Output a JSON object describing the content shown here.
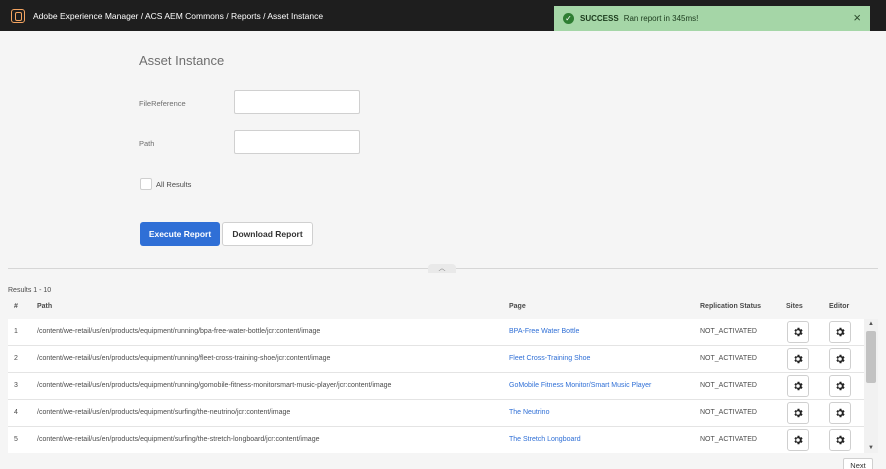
{
  "header": {
    "breadcrumb": "Adobe Experience Manager / ACS AEM Commons / Reports / Asset Instance"
  },
  "toast": {
    "status": "SUCCESS",
    "message": "Ran report in 345ms!",
    "close": "×"
  },
  "form": {
    "title": "Asset Instance",
    "file_reference_label": "FileReference",
    "file_reference_value": "",
    "path_label": "Path",
    "path_value": "",
    "all_results_label": "All Results",
    "execute_label": "Execute Report",
    "download_label": "Download Report"
  },
  "results": {
    "count_text": "Results 1 - 10",
    "headers": {
      "num": "#",
      "path": "Path",
      "page": "Page",
      "status": "Replication Status",
      "sites": "Sites",
      "editor": "Editor"
    },
    "rows": [
      {
        "num": "1",
        "path": "/content/we-retail/us/en/products/equipment/running/bpa-free-water-bottle/jcr:content/image",
        "page": "BPA-Free Water Bottle",
        "status": "NOT_ACTIVATED"
      },
      {
        "num": "2",
        "path": "/content/we-retail/us/en/products/equipment/running/fleet-cross-training-shoe/jcr:content/image",
        "page": "Fleet Cross-Training Shoe",
        "status": "NOT_ACTIVATED"
      },
      {
        "num": "3",
        "path": "/content/we-retail/us/en/products/equipment/running/gomobile-fitness-monitorsmart-music-player/jcr:content/image",
        "page": "GoMobile Fitness Monitor/Smart Music Player",
        "status": "NOT_ACTIVATED"
      },
      {
        "num": "4",
        "path": "/content/we-retail/us/en/products/equipment/surfing/the-neutrino/jcr:content/image",
        "page": "The Neutrino",
        "status": "NOT_ACTIVATED"
      },
      {
        "num": "5",
        "path": "/content/we-retail/us/en/products/equipment/surfing/the-stretch-longboard/jcr:content/image",
        "page": "The Stretch Longboard",
        "status": "NOT_ACTIVATED"
      }
    ]
  },
  "pagination": {
    "next_label": "Next"
  },
  "colors": {
    "primary": "#2f6fd6",
    "success_bg": "#a5d6a7",
    "topbar": "#1e1e1e"
  },
  "icons": {
    "brand": "aem-logo-icon",
    "success": "check-circle-icon",
    "close": "close-icon",
    "gear": "gear-icon",
    "collapse": "chevron-up-icon"
  }
}
